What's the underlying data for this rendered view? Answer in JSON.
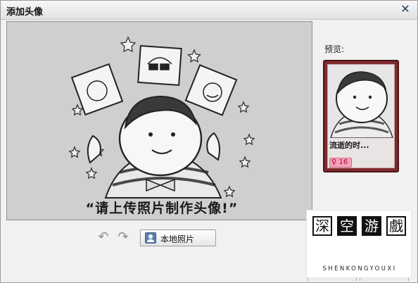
{
  "dialog": {
    "title": "添加头像",
    "close_icon": "close-icon"
  },
  "editor": {
    "placeholder_caption": "“请上传照片制作头像!”",
    "background_color": "#cfcfcf"
  },
  "toolbar": {
    "rotate_left_icon": "rotate-left-icon",
    "rotate_right_icon": "rotate-right-icon",
    "upload_label": "本地照片",
    "upload_icon": "photo-icon"
  },
  "preview": {
    "label": "预览:",
    "card_name": "流逝的时...",
    "card_badge": "♀ 16",
    "card_frame_color": "#7e2a2e"
  },
  "watermark": {
    "chars": [
      "深",
      "空",
      "游",
      "戲"
    ],
    "latin": "SHENKONGYOUXI"
  }
}
